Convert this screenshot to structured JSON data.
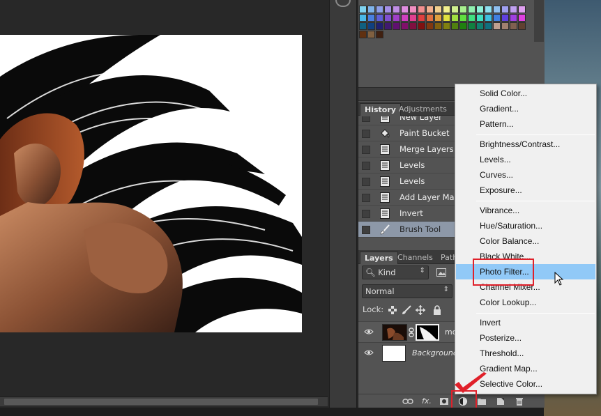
{
  "history": {
    "tabs": [
      "History",
      "Adjustments"
    ],
    "items": [
      {
        "label": "New Layer",
        "icon": "document-icon",
        "selected": false
      },
      {
        "label": "Paint Bucket",
        "icon": "paint-bucket-icon",
        "selected": false
      },
      {
        "label": "Merge Layers",
        "icon": "document-icon",
        "selected": false
      },
      {
        "label": "Levels",
        "icon": "document-icon",
        "selected": false
      },
      {
        "label": "Levels",
        "icon": "document-icon",
        "selected": false
      },
      {
        "label": "Add Layer Mask",
        "icon": "document-icon",
        "selected": false
      },
      {
        "label": "Invert",
        "icon": "document-icon",
        "selected": false
      },
      {
        "label": "Brush Tool",
        "icon": "brush-icon",
        "selected": true
      }
    ]
  },
  "layers": {
    "tabs": [
      "Layers",
      "Channels",
      "Path"
    ],
    "filter_value": "Kind",
    "blend_mode": "Normal",
    "lock_label": "Lock:",
    "rows": [
      {
        "name": "mo",
        "visible": true
      },
      {
        "name": "Background",
        "visible": true
      }
    ],
    "bottom_icons": [
      "link-icon",
      "fx-icon",
      "mask-icon",
      "adjustment-layer-icon",
      "folder-icon",
      "new-layer-icon",
      "trash-icon"
    ],
    "fx_label": "fx."
  },
  "adjustment_menu": {
    "groups": [
      [
        "Solid Color...",
        "Gradient...",
        "Pattern..."
      ],
      [
        "Brightness/Contrast...",
        "Levels...",
        "Curves...",
        "Exposure..."
      ],
      [
        "Vibrance...",
        "Hue/Saturation...",
        "Color Balance...",
        "Black  White...",
        "Photo Filter...",
        "Channel Mixer...",
        "Color Lookup..."
      ],
      [
        "Invert",
        "Posterize...",
        "Threshold...",
        "Gradient Map...",
        "Selective Color..."
      ]
    ],
    "highlighted": "Photo Filter..."
  },
  "colors": {
    "panel_bg": "#535353",
    "menu_highlight": "#91c9f7",
    "annotation_red": "#e0202a",
    "selected_history_row": "#8d98a8"
  }
}
